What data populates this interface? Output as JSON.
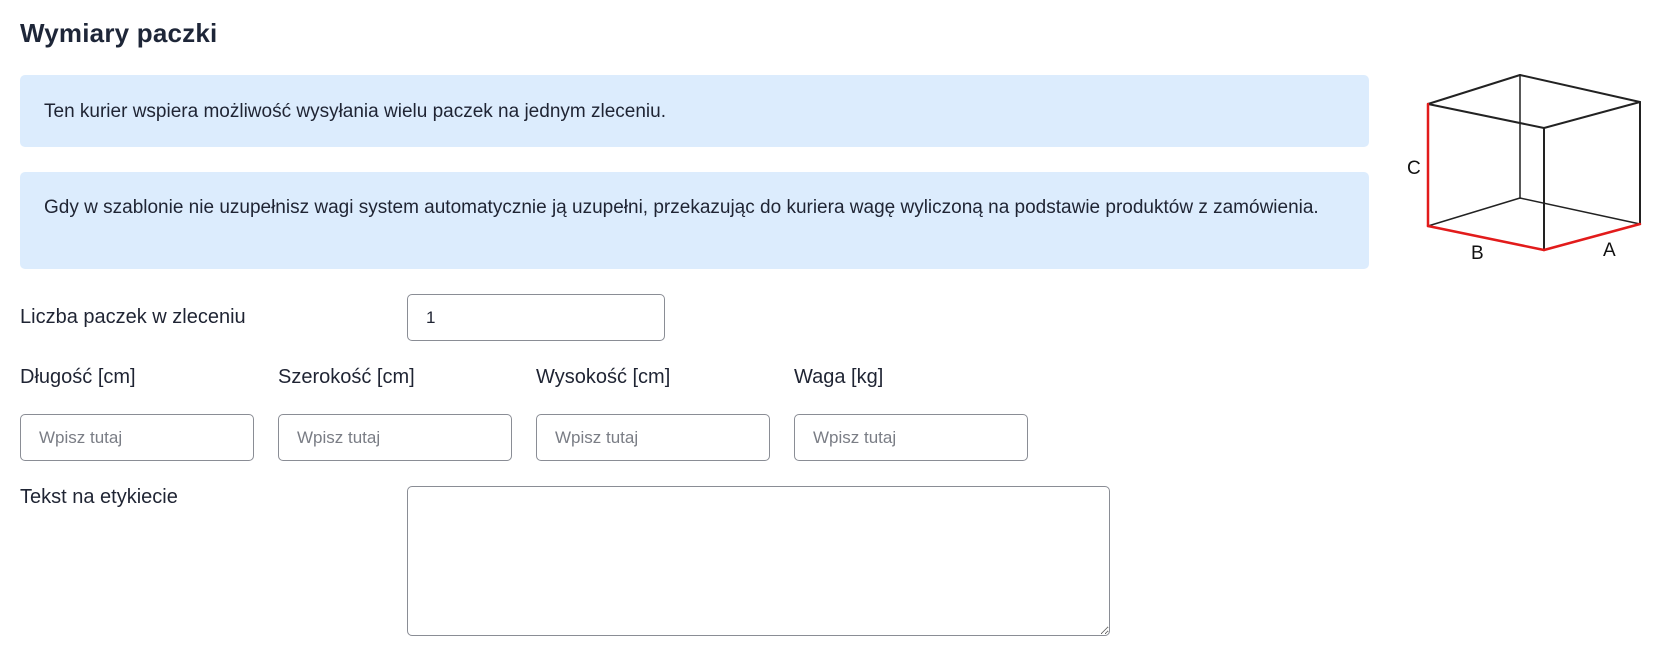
{
  "section": {
    "title": "Wymiary paczki"
  },
  "info": {
    "multi_parcel": "Ten kurier wspiera możliwość wysyłania wielu paczek na jednym zleceniu.",
    "weight_note": "Gdy w szablonie nie uzupełnisz wagi system automatycznie ją uzupełni, przekazując do kuriera wagę wyliczoną na podstawie produktów z zamówienia."
  },
  "form": {
    "parcel_count": {
      "label": "Liczba paczek w zleceniu",
      "value": "1"
    },
    "length": {
      "label": "Długość [cm]",
      "placeholder": "Wpisz tutaj"
    },
    "width": {
      "label": "Szerokość [cm]",
      "placeholder": "Wpisz tutaj"
    },
    "height": {
      "label": "Wysokość [cm]",
      "placeholder": "Wpisz tutaj"
    },
    "weight": {
      "label": "Waga [kg]",
      "placeholder": "Wpisz tutaj"
    },
    "label_text": {
      "label": "Tekst na etykiecie",
      "value": ""
    }
  },
  "diagram": {
    "label_c": "C",
    "label_b": "B",
    "label_a": "A",
    "edge_color": "#222222",
    "highlight_color": "#e21b1b"
  }
}
